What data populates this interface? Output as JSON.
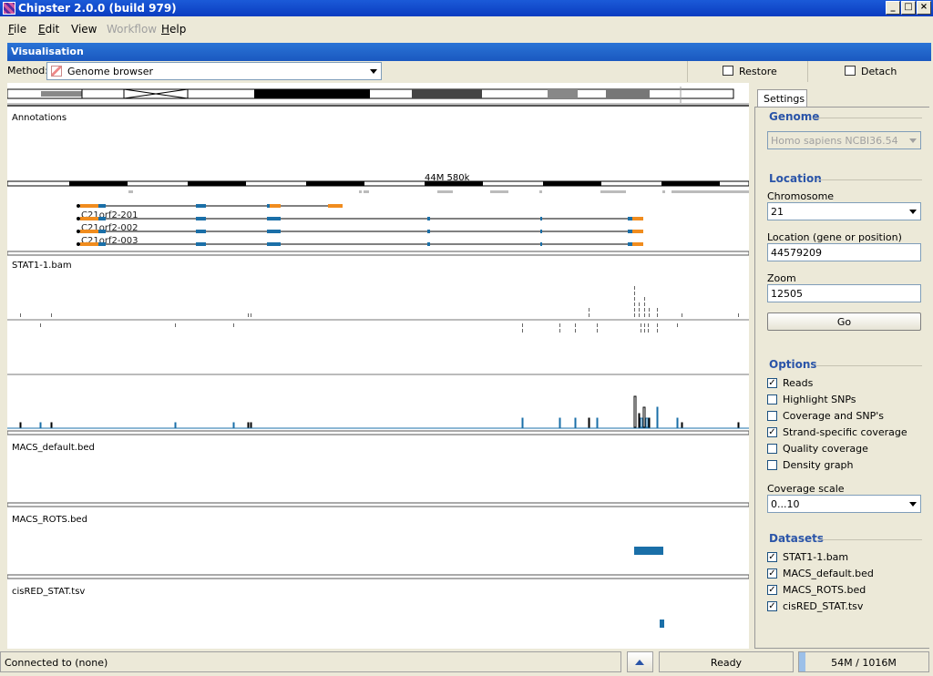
{
  "window": {
    "title": "Chipster 2.0.0 (build 979)",
    "controls": [
      "_",
      "□",
      "×"
    ]
  },
  "menu": [
    {
      "label": "File",
      "mnemonic": "F",
      "rest": "ile",
      "enabled": true
    },
    {
      "label": "Edit",
      "mnemonic": "E",
      "rest": "dit",
      "enabled": true
    },
    {
      "label": "View",
      "mnemonic": "",
      "rest": "View",
      "enabled": true
    },
    {
      "label": "Workflow",
      "mnemonic": "",
      "rest": "Workflow",
      "enabled": false
    },
    {
      "label": "Help",
      "mnemonic": "H",
      "rest": "elp",
      "enabled": true
    }
  ],
  "panel": {
    "title": "Visualisation",
    "method_label": "Method:",
    "method_value": "Genome browser",
    "restore_label": "Restore",
    "detach_label": "Detach"
  },
  "browser": {
    "ruler_label": "44M 580k",
    "tracks": [
      {
        "name": "Annotations"
      },
      {
        "name": "STAT1-1.bam"
      },
      {
        "name": "MACS_default.bed"
      },
      {
        "name": "MACS_ROTS.bed"
      },
      {
        "name": "cisRED_STAT.tsv"
      }
    ],
    "transcripts": [
      "C21orf2-201",
      "C21orf2-002",
      "C21orf2-003"
    ]
  },
  "settings": {
    "tab_label": "Settings",
    "genome_section": "Genome",
    "genome_value": "Homo sapiens NCBI36.54",
    "location_section": "Location",
    "chromosome_label": "Chromosome",
    "chromosome_value": "21",
    "location_label": "Location (gene or position)",
    "location_value": "44579209",
    "zoom_label": "Zoom",
    "zoom_value": "12505",
    "go_label": "Go",
    "options_section": "Options",
    "options": [
      {
        "label": "Reads",
        "checked": true
      },
      {
        "label": "Highlight SNPs",
        "checked": false
      },
      {
        "label": "Coverage and SNP's",
        "checked": false
      },
      {
        "label": "Strand-specific coverage",
        "checked": true
      },
      {
        "label": "Quality coverage",
        "checked": false
      },
      {
        "label": "Density graph",
        "checked": false
      }
    ],
    "coverage_scale_label": "Coverage scale",
    "coverage_scale_value": "0...10",
    "datasets_section": "Datasets",
    "datasets": [
      {
        "label": "STAT1-1.bam",
        "checked": true
      },
      {
        "label": "MACS_default.bed",
        "checked": true
      },
      {
        "label": "MACS_ROTS.bed",
        "checked": true
      },
      {
        "label": "cisRED_STAT.tsv",
        "checked": true
      }
    ]
  },
  "status": {
    "connection": "Connected to (none)",
    "state": "Ready",
    "memory": "54M / 1016M"
  },
  "colors": {
    "exon_blue": "#1a6fa8",
    "utr_orange": "#f08c1e",
    "title_blue": "#0a3cc0",
    "section_blue": "#2a54a8"
  }
}
